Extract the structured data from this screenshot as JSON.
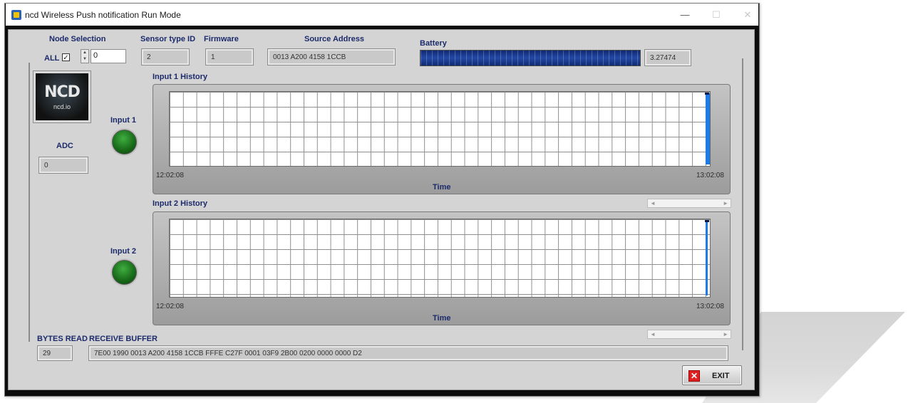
{
  "window": {
    "title": "ncd Wireless Push notification Run Mode",
    "controls": {
      "minimize": "—",
      "maximize": "☐",
      "close": "✕"
    }
  },
  "node_selection": {
    "label": "Node Selection",
    "all_label": "ALL",
    "all_checked": true,
    "check_mark": "✓",
    "value": "0"
  },
  "sensor_type": {
    "label": "Sensor type ID",
    "value": "2"
  },
  "firmware": {
    "label": "Firmware",
    "value": "1"
  },
  "source_address": {
    "label": "Source Address",
    "value": "0013 A200 4158 1CCB"
  },
  "battery": {
    "label": "Battery",
    "value": "3.27474"
  },
  "logo": {
    "text": "NCD",
    "subtext": "ncd.io"
  },
  "adc": {
    "label": "ADC",
    "value": "0"
  },
  "input1": {
    "label": "Input 1",
    "led_color": "#2f8f2f"
  },
  "input2": {
    "label": "Input 2",
    "led_color": "#2f8f2f"
  },
  "chart_data": [
    {
      "type": "line",
      "title": "Input 1 History",
      "xlabel": "Time",
      "x_ticks": [
        "12:02:08",
        "13:02:08"
      ],
      "series": [
        {
          "values": [
            0,
            1
          ]
        }
      ],
      "grid": true
    },
    {
      "type": "line",
      "title": "Input 2 History",
      "xlabel": "Time",
      "x_ticks": [
        "12:02:08",
        "13:02:08"
      ],
      "series": [
        {
          "values": [
            0,
            1
          ]
        }
      ],
      "grid": true
    }
  ],
  "bytes_read": {
    "label": "BYTES READ",
    "value": "29"
  },
  "receive_buffer": {
    "label": "RECEIVE BUFFER",
    "value": "7E00 1990 0013 A200 4158 1CCB FFFE C27F 0001 03F9 2B00 0200 0000 0000 D2"
  },
  "scroll_arrows": {
    "left": "◄",
    "right": "►"
  },
  "exit_button": {
    "label": "EXIT",
    "icon": "✕"
  }
}
